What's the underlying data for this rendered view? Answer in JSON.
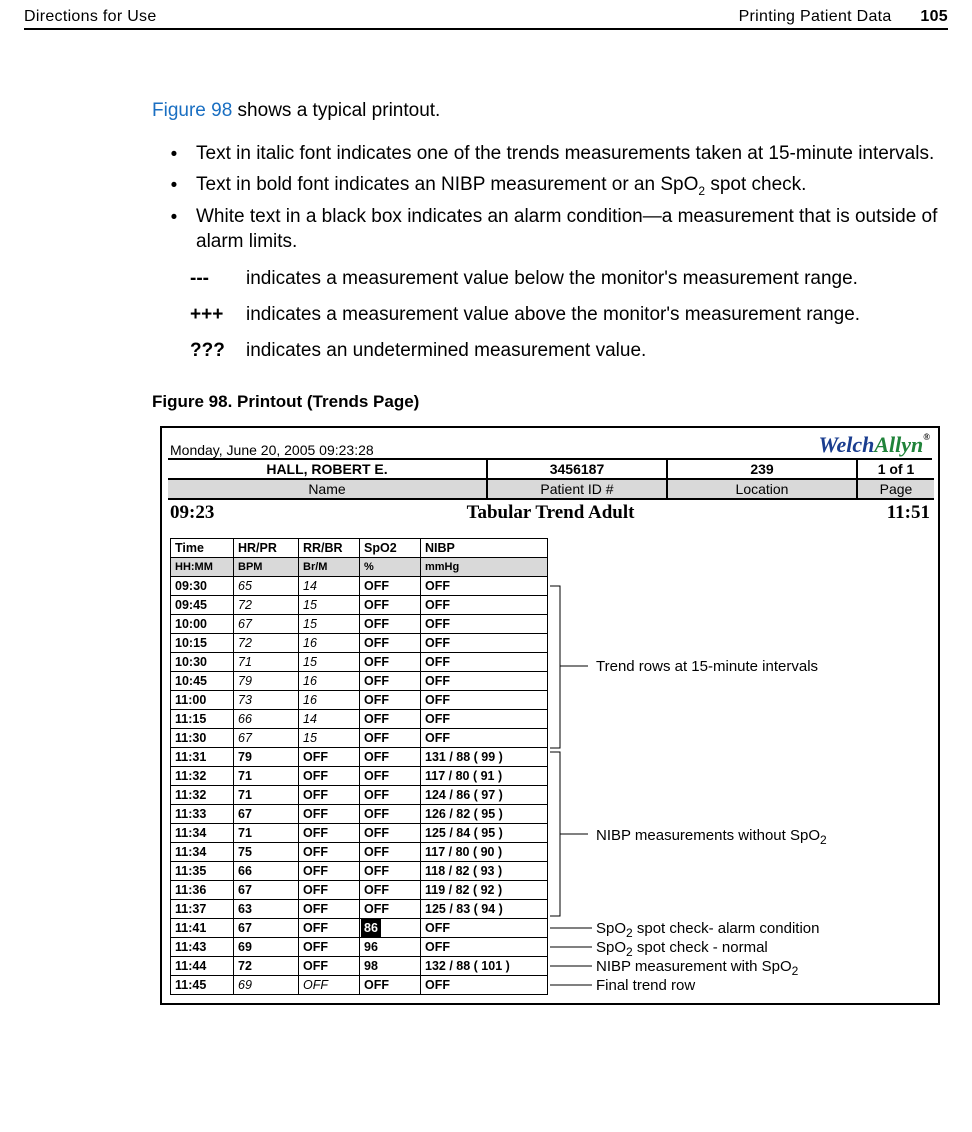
{
  "header": {
    "left": "Directions for Use",
    "right": "Printing Patient Data",
    "page": "105"
  },
  "intro": {
    "pre": "Figure 98",
    "post": " shows a typical printout."
  },
  "bullets": [
    "Text in italic font indicates one of the trends measurements taken at 15-minute intervals.",
    "Text in bold font indicates an NIBP measurement or an SpO₂ spot check.",
    "White text in a black box indicates an alarm condition—a measurement that is outside of alarm limits."
  ],
  "defs": [
    {
      "sym": "---",
      "txt": "indicates a measurement value below the monitor's measurement range."
    },
    {
      "sym": "+++",
      "txt": "indicates a measurement value above the monitor's measurement range."
    },
    {
      "sym": "???",
      "txt": "indicates an undetermined measurement value."
    }
  ],
  "figcap": "Figure 98.  Printout (Trends Page)",
  "printout": {
    "timestamp": "Monday, June 20, 2005  09:23:28",
    "logo": {
      "a": "Welch",
      "b": "Allyn",
      "reg": "®"
    },
    "row1": {
      "name": "HALL, ROBERT E.",
      "id": "3456187",
      "loc": "239",
      "page": "1 of 1"
    },
    "row2": {
      "name": "Name",
      "id": "Patient ID #",
      "loc": "Location",
      "page": "Page"
    },
    "title": {
      "l": "09:23",
      "c": "Tabular Trend Adult",
      "r": "11:51"
    },
    "cols": [
      "Time",
      "HR/PR",
      "RR/BR",
      "SpO2",
      "NIBP"
    ],
    "units": [
      "HH:MM",
      "BPM",
      "Br/M",
      "%",
      "mmHg"
    ],
    "rows": [
      {
        "t": "09:30",
        "hr": "65",
        "rr": "14",
        "sp": "OFF",
        "ni": "OFF",
        "style": "ital"
      },
      {
        "t": "09:45",
        "hr": "72",
        "rr": "15",
        "sp": "OFF",
        "ni": "OFF",
        "style": "ital"
      },
      {
        "t": "10:00",
        "hr": "67",
        "rr": "15",
        "sp": "OFF",
        "ni": "OFF",
        "style": "ital"
      },
      {
        "t": "10:15",
        "hr": "72",
        "rr": "16",
        "sp": "OFF",
        "ni": "OFF",
        "style": "ital"
      },
      {
        "t": "10:30",
        "hr": "71",
        "rr": "15",
        "sp": "OFF",
        "ni": "OFF",
        "style": "ital"
      },
      {
        "t": "10:45",
        "hr": "79",
        "rr": "16",
        "sp": "OFF",
        "ni": "OFF",
        "style": "ital"
      },
      {
        "t": "11:00",
        "hr": "73",
        "rr": "16",
        "sp": "OFF",
        "ni": "OFF",
        "style": "ital"
      },
      {
        "t": "11:15",
        "hr": "66",
        "rr": "14",
        "sp": "OFF",
        "ni": "OFF",
        "style": "ital"
      },
      {
        "t": "11:30",
        "hr": "67",
        "rr": "15",
        "sp": "OFF",
        "ni": "OFF",
        "style": "ital"
      },
      {
        "t": "11:31",
        "hr": "79",
        "rr": "OFF",
        "sp": "OFF",
        "ni": "131 / 88 ( 99 )",
        "style": "bold"
      },
      {
        "t": "11:32",
        "hr": "71",
        "rr": "OFF",
        "sp": "OFF",
        "ni": "117 / 80 ( 91 )",
        "style": "bold"
      },
      {
        "t": "11:32",
        "hr": "71",
        "rr": "OFF",
        "sp": "OFF",
        "ni": "124 / 86 ( 97 )",
        "style": "bold"
      },
      {
        "t": "11:33",
        "hr": "67",
        "rr": "OFF",
        "sp": "OFF",
        "ni": "126 / 82 ( 95 )",
        "style": "bold"
      },
      {
        "t": "11:34",
        "hr": "71",
        "rr": "OFF",
        "sp": "OFF",
        "ni": "125 / 84 ( 95 )",
        "style": "bold"
      },
      {
        "t": "11:34",
        "hr": "75",
        "rr": "OFF",
        "sp": "OFF",
        "ni": "117 / 80 ( 90 )",
        "style": "bold"
      },
      {
        "t": "11:35",
        "hr": "66",
        "rr": "OFF",
        "sp": "OFF",
        "ni": "118 / 82 ( 93 )",
        "style": "bold"
      },
      {
        "t": "11:36",
        "hr": "67",
        "rr": "OFF",
        "sp": "OFF",
        "ni": "119 / 82 ( 92 )",
        "style": "bold"
      },
      {
        "t": "11:37",
        "hr": "63",
        "rr": "OFF",
        "sp": "OFF",
        "ni": "125 / 83 ( 94 )",
        "style": "bold"
      },
      {
        "t": "11:41",
        "hr": "67",
        "rr": "OFF",
        "sp": "86",
        "ni": "OFF",
        "style": "bold",
        "sp_alarm": true
      },
      {
        "t": "11:43",
        "hr": "69",
        "rr": "OFF",
        "sp": "96",
        "ni": "OFF",
        "style": "bold"
      },
      {
        "t": "11:44",
        "hr": "72",
        "rr": "OFF",
        "sp": "98",
        "ni": "132 / 88 ( 101 )",
        "style": "bold"
      },
      {
        "t": "11:45",
        "hr": "69",
        "rr": "OFF",
        "sp": "OFF",
        "ni": "OFF",
        "style": "ital"
      }
    ]
  },
  "annotations": {
    "trend": "Trend rows at 15-minute intervals",
    "nibp": "NIBP measurements without SpO",
    "a1": "SpO₂ spot check- alarm condition",
    "a2": "SpO₂ spot check - normal",
    "a3": "NIBP measurement with SpO",
    "a4": "Final trend row",
    "sub2": "2"
  }
}
